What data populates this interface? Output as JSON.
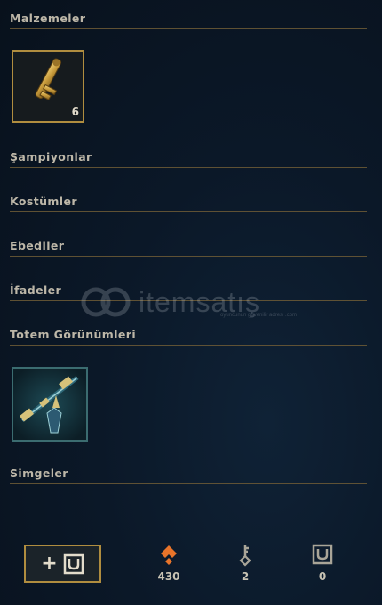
{
  "sections": {
    "materials": "Malzemeler",
    "champions": "Şampiyonlar",
    "skins": "Kostümler",
    "eternals": "Ebediler",
    "emotes": "İfadeler",
    "ward_skins": "Totem Görünümleri",
    "icons": "Simgeler"
  },
  "materials_item": {
    "icon": "hextech-key-icon",
    "count": "6"
  },
  "ward_item": {
    "icon": "ward-totem-icon"
  },
  "watermark": {
    "text": "itemsatış",
    "sub": "oyuncunun güvenilir adresi .com"
  },
  "currencies": {
    "orange_essence": {
      "icon": "orange-essence-icon",
      "value": "430"
    },
    "key_fragments": {
      "icon": "key-fragment-icon",
      "value": "2"
    },
    "chests": {
      "icon": "chest-icon",
      "value": "0"
    }
  },
  "add_button": {
    "label": "+",
    "icon": "chest-icon"
  },
  "colors": {
    "gold": "#b08d3f",
    "teal_border": "#3b6c70",
    "orange": "#e8742a",
    "bg": "#0b1828"
  }
}
